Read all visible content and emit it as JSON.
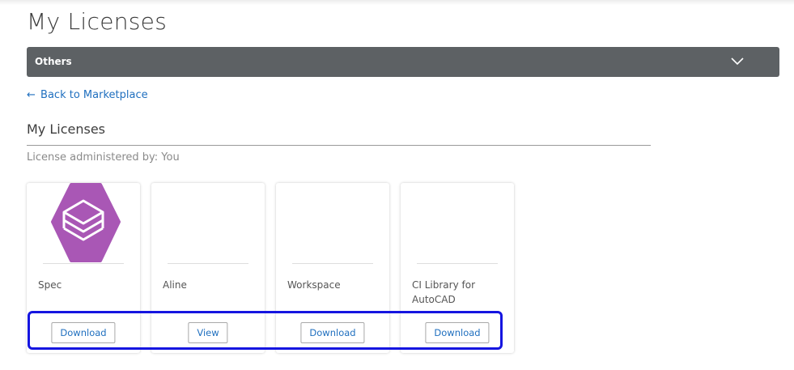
{
  "page": {
    "title": "My Licenses"
  },
  "filter": {
    "selected": "Others",
    "icon": "chevron-down-icon"
  },
  "back_link": {
    "arrow": "←",
    "label": "Back to Marketplace"
  },
  "section": {
    "title": "My Licenses",
    "admin_note": "License administered by: You"
  },
  "cards": [
    {
      "name": "Spec",
      "button": "Download",
      "icon": "spec-logo-icon",
      "icon_color": "#a957b5"
    },
    {
      "name": "Aline",
      "button": "View"
    },
    {
      "name": "Workspace",
      "button": "Download"
    },
    {
      "name": "CI Library for AutoCAD",
      "button": "Download"
    }
  ],
  "colors": {
    "accent": "#1f6fbf",
    "dropdown_bg": "#5d6164",
    "highlight": "#1515e0"
  }
}
